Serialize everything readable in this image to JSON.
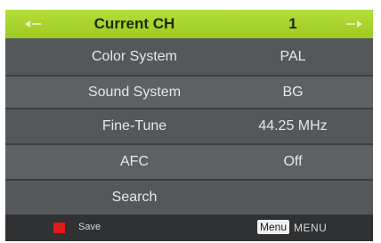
{
  "menu": {
    "header": {
      "label": "Current CH",
      "value": "1"
    },
    "items": [
      {
        "label": "Color System",
        "value": "PAL"
      },
      {
        "label": "Sound System",
        "value": "BG"
      },
      {
        "label": "Fine-Tune",
        "value": "44.25 MHz"
      },
      {
        "label": "AFC",
        "value": "Off"
      },
      {
        "label": "Search",
        "value": ""
      }
    ]
  },
  "footer": {
    "save_label": "Save",
    "menu_key_label": "Menu",
    "menu_label": "MENU"
  },
  "colors": {
    "selected_row": "#a8d42c",
    "save_icon": "#e3191b"
  }
}
